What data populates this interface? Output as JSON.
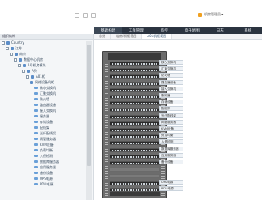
{
  "topbar": {
    "user_label": "机房管理员 ▾"
  },
  "nav": {
    "items": [
      {
        "label": "基础构建",
        "active": true
      },
      {
        "label": "工单管理",
        "active": false
      },
      {
        "label": "监控",
        "active": false
      },
      {
        "label": "电子地图",
        "active": false
      },
      {
        "label": "日志",
        "active": false
      },
      {
        "label": "系统",
        "active": false
      }
    ]
  },
  "left": {
    "header": "组织结构",
    "tree": [
      {
        "label": "Country",
        "depth": 0,
        "icon": "globe-icon"
      },
      {
        "label": "江苏",
        "depth": 1,
        "icon": "folder-icon"
      },
      {
        "label": "南京",
        "depth": 2,
        "icon": "folder-icon"
      },
      {
        "label": "数据中心机房",
        "depth": 3,
        "icon": "folder-icon"
      },
      {
        "label": "1号机房模块",
        "depth": 4,
        "icon": "folder-icon"
      },
      {
        "label": "A列",
        "depth": 5,
        "icon": "folder-icon"
      },
      {
        "label": "A01柜",
        "depth": 6,
        "icon": "rack-icon"
      },
      {
        "label": "网络设备机柜",
        "depth": 7,
        "icon": "rack-icon"
      },
      {
        "label": "核心交换机",
        "depth": 8,
        "icon": "device-icon"
      },
      {
        "label": "汇聚交换机",
        "depth": 8,
        "icon": "device-icon"
      },
      {
        "label": "防火墙",
        "depth": 8,
        "icon": "device-icon"
      },
      {
        "label": "路由器设备",
        "depth": 8,
        "icon": "device-icon"
      },
      {
        "label": "接入交换机",
        "depth": 8,
        "icon": "device-icon"
      },
      {
        "label": "服务器",
        "depth": 8,
        "icon": "device-icon"
      },
      {
        "label": "存储设备",
        "depth": 8,
        "icon": "device-icon"
      },
      {
        "label": "配线架",
        "depth": 8,
        "icon": "device-icon"
      },
      {
        "label": "光纤配线架",
        "depth": 8,
        "icon": "device-icon"
      },
      {
        "label": "网管服务器",
        "depth": 8,
        "icon": "device-icon"
      },
      {
        "label": "KVM设备",
        "depth": 8,
        "icon": "device-icon"
      },
      {
        "label": "负载均衡",
        "depth": 8,
        "icon": "device-icon"
      },
      {
        "label": "入侵检测",
        "depth": 8,
        "icon": "device-icon"
      },
      {
        "label": "数据库服务器",
        "depth": 8,
        "icon": "device-icon"
      },
      {
        "label": "应用服务器",
        "depth": 8,
        "icon": "device-icon"
      },
      {
        "label": "备份设备",
        "depth": 8,
        "icon": "device-icon"
      },
      {
        "label": "UPS电源",
        "depth": 8,
        "icon": "device-icon"
      },
      {
        "label": "PDU电源",
        "depth": 8,
        "icon": "device-icon"
      }
    ]
  },
  "tabs": [
    {
      "label": "总览",
      "active": false
    },
    {
      "label": "机房/机柜视图",
      "active": false
    },
    {
      "label": "A01机柜视图",
      "active": true
    }
  ],
  "rack": {
    "slots": [
      {
        "filled": true,
        "label": "核心交换机"
      },
      {
        "filled": true,
        "label": "汇聚交换机"
      },
      {
        "filled": true,
        "label": "防火墙"
      },
      {
        "filled": true,
        "label": "路由器设备"
      },
      {
        "filled": true,
        "label": "接入交换机"
      },
      {
        "filled": true,
        "label": "服务器"
      },
      {
        "filled": true,
        "label": "存储设备"
      },
      {
        "filled": true,
        "label": "配线架"
      },
      {
        "filled": true,
        "label": "光纤配线架"
      },
      {
        "filled": true,
        "label": "网管服务器"
      },
      {
        "filled": true,
        "label": "KVM设备"
      },
      {
        "filled": true,
        "label": "负载均衡"
      },
      {
        "filled": true,
        "label": "入侵检测"
      },
      {
        "filled": true,
        "label": "数据库服务器"
      },
      {
        "filled": true,
        "label": "应用服务器"
      },
      {
        "filled": true,
        "label": "备份设备"
      },
      {
        "filled": false,
        "label": ""
      },
      {
        "filled": false,
        "label": ""
      },
      {
        "filled": true,
        "label": "UPS电源"
      },
      {
        "filled": true,
        "label": "PDU电源"
      }
    ]
  },
  "colors": {
    "nav_bg": "#2b3440",
    "accent": "#f0a020",
    "rack": "#6c6c6c"
  }
}
